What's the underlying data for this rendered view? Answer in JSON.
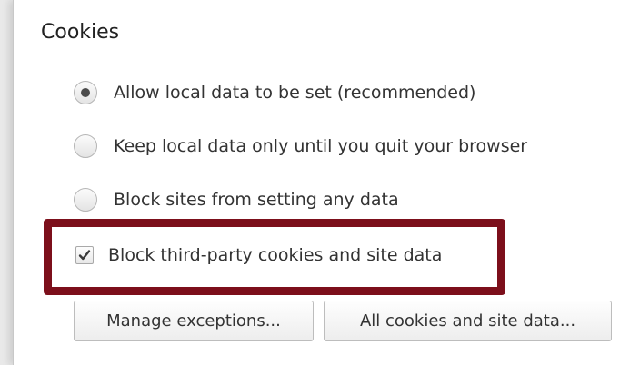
{
  "section": {
    "title": "Cookies"
  },
  "options": [
    {
      "label": "Allow local data to be set (recommended)",
      "type": "radio",
      "checked": true
    },
    {
      "label": "Keep local data only until you quit your browser",
      "type": "radio",
      "checked": false
    },
    {
      "label": "Block sites from setting any data",
      "type": "radio",
      "checked": false
    },
    {
      "label": "Block third-party cookies and site data",
      "type": "checkbox",
      "checked": true
    }
  ],
  "buttons": {
    "manage_exceptions": "Manage exceptions...",
    "all_cookies": "All cookies and site data..."
  },
  "colors": {
    "highlight": "#7c0f1b",
    "panel_background": "#ffffff",
    "page_background": "#e9e9e9"
  }
}
